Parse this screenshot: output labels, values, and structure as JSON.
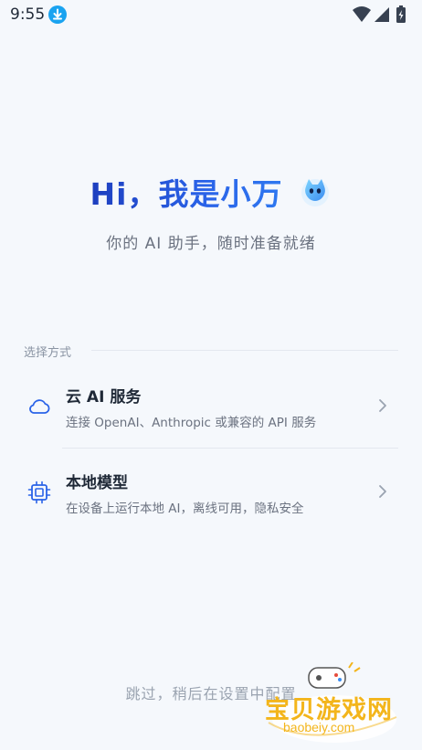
{
  "status_bar": {
    "time": "9:55"
  },
  "greeting": {
    "title": "Hi，我是小万",
    "subtitle": "你的 AI 助手，随时准备就绪"
  },
  "section": {
    "label": "选择方式"
  },
  "options": [
    {
      "title": "云 AI 服务",
      "description": "连接 OpenAI、Anthropic 或兼容的 API 服务",
      "icon": "cloud-icon"
    },
    {
      "title": "本地模型",
      "description": "在设备上运行本地 AI，离线可用，隐私安全",
      "icon": "chip-icon"
    }
  ],
  "skip_text": "跳过，稍后在设置中配置",
  "watermark": {
    "text": "宝贝游戏网",
    "url": "baobeiy.com"
  },
  "colors": {
    "accent": "#2a63e8",
    "background": "#f5f8fc",
    "watermark": "#f3b51b"
  }
}
